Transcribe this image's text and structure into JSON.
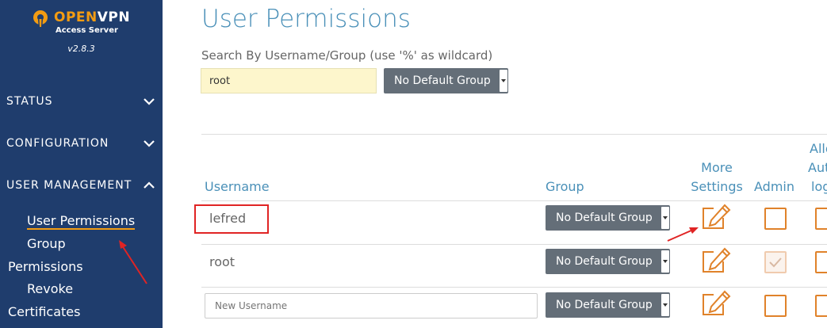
{
  "brand": {
    "logo_name": "OPENVPN",
    "logo_sub": "Access Server",
    "version": "v2.8.3"
  },
  "sidebar": {
    "sections": [
      {
        "label": "STATUS",
        "expanded": false
      },
      {
        "label": "CONFIGURATION",
        "expanded": false
      },
      {
        "label": "USER MANAGEMENT",
        "expanded": true
      }
    ],
    "subitems": [
      {
        "label": "User Permissions",
        "active": true
      },
      {
        "label": "Group"
      },
      {
        "label": "Permissions"
      },
      {
        "label": "Revoke"
      },
      {
        "label": "Certificates"
      }
    ]
  },
  "main": {
    "title": "User Permissions",
    "search_label": "Search By Username/Group (use '%' as wildcard)",
    "search_value": "root",
    "search_group_select": "No Default Group"
  },
  "table": {
    "headers": {
      "username": "Username",
      "group": "Group",
      "more_settings_line1": "More",
      "more_settings_line2": "Settings",
      "admin": "Admin",
      "allow_line1": "Allo",
      "allow_line2": "Aut",
      "allow_line3": "log"
    },
    "rows": [
      {
        "username": "lefred",
        "group": "No Default Group",
        "admin": false
      },
      {
        "username": "root",
        "group": "No Default Group",
        "admin": true
      }
    ],
    "new_row": {
      "placeholder": "New Username",
      "group": "No Default Group",
      "admin": false
    }
  },
  "colors": {
    "sidebar_bg": "#1f3d6d",
    "accent": "#f39c12",
    "title_blue": "#4a90b8",
    "icon_orange": "#e0822a",
    "annotation_red": "#e02424"
  }
}
